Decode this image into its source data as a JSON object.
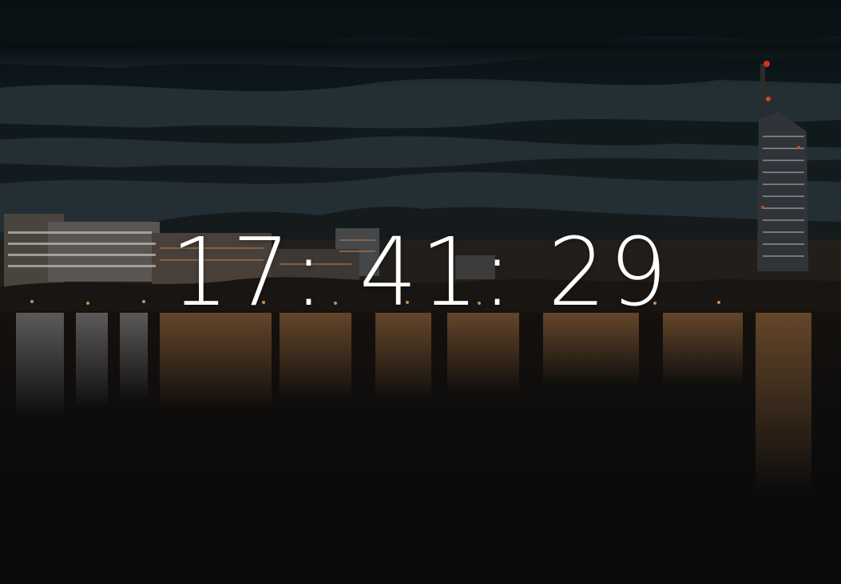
{
  "clock": {
    "time": "17: 41: 29"
  },
  "background": {
    "description_icon": "night-city-lake-photo",
    "colors": {
      "sky_dark": "#0b1418",
      "sky_teal": "#13262d",
      "lights_warm": "#d08a4a",
      "water": "#0e0e0f",
      "beacon": "#ff3b1f"
    }
  }
}
